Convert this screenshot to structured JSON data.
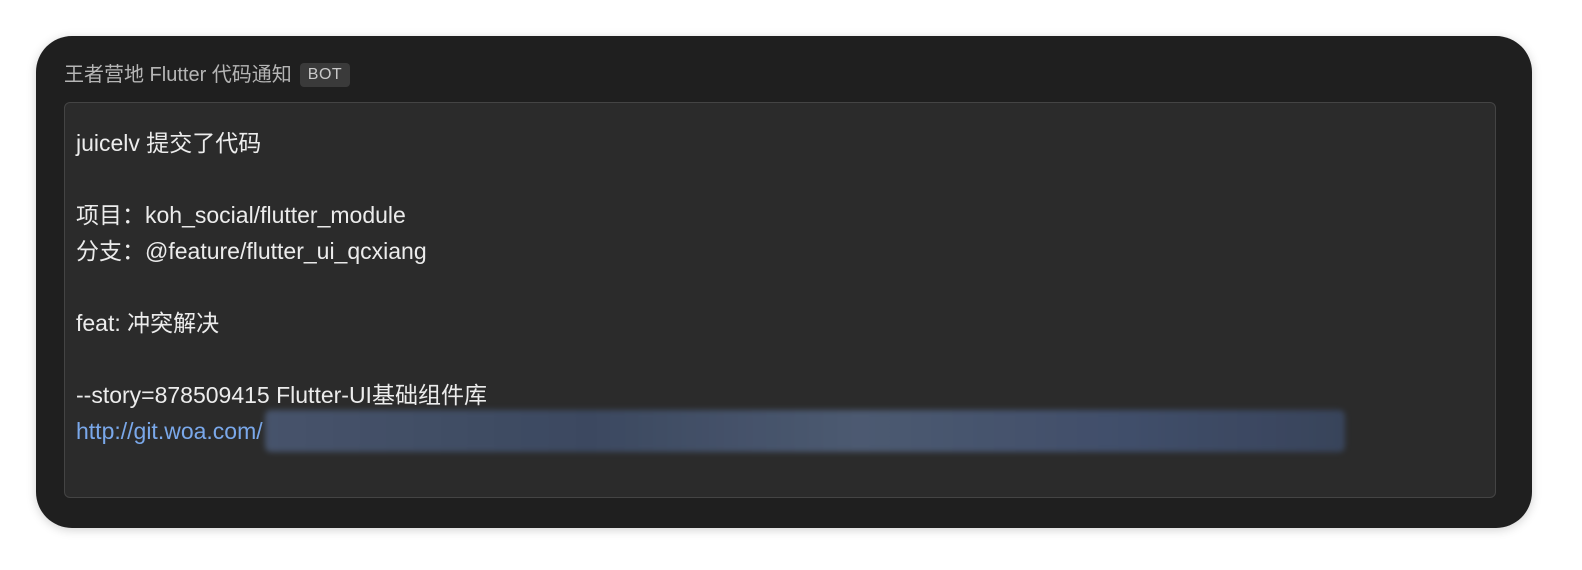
{
  "message": {
    "sender": "王者营地 Flutter 代码通知",
    "badge": "BOT",
    "lines": {
      "title": "juicelv 提交了代码",
      "project": "项目：koh_social/flutter_module",
      "branch": "分支：@feature/flutter_ui_qcxiang",
      "commit": "feat: 冲突解决",
      "story": "--story=878509415 Flutter-UI基础组件库",
      "link_prefix": "http://git.woa.com/"
    }
  }
}
